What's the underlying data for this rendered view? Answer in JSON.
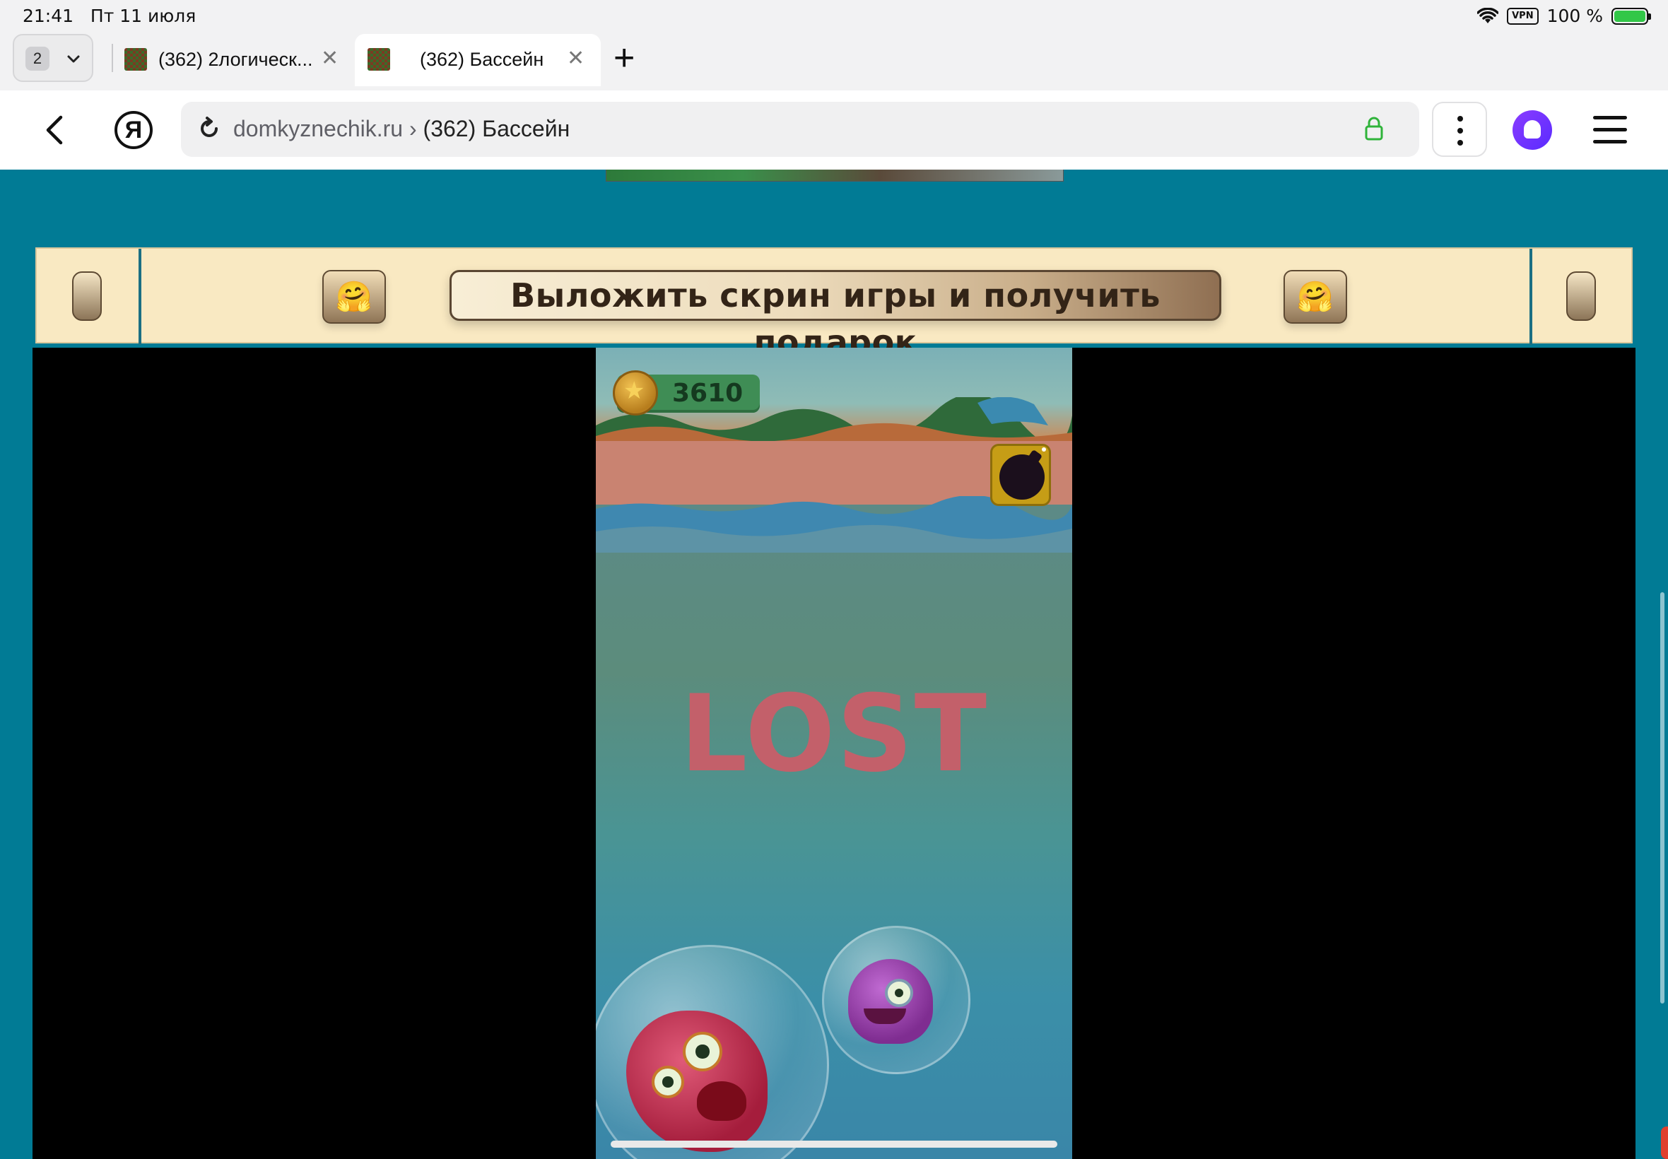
{
  "status_bar": {
    "time": "21:41",
    "date": "Пт 11 июля",
    "vpn": "VPN",
    "battery_text": "100 %",
    "icons": [
      "wifi-icon",
      "battery-charging-icon"
    ]
  },
  "tabs": {
    "count": "2",
    "items": [
      {
        "title": "(362) 2логическ...",
        "active": false
      },
      {
        "title": "(362) Бассейн",
        "active": true
      }
    ],
    "close_glyph": "✕",
    "new_tab_glyph": "+"
  },
  "address_bar": {
    "domain": "domkyznechik.ru",
    "separator": " › ",
    "page_title": "(362) Бассейн",
    "ya_logo": "Я"
  },
  "banner": {
    "button_text": "Выложить скрин игры и получить подарок",
    "emoji": "🤗"
  },
  "game": {
    "coins": "3610",
    "status_text": "LOST"
  },
  "colors": {
    "page_background": "#017b95",
    "banner_background": "#f9e9c2",
    "lost_text": "#c3606a",
    "coin_panel": "#3f8d55",
    "bomb_button": "#c69d16",
    "secure_lock": "#2fb33a",
    "alice_accent": "#7a36ff"
  }
}
